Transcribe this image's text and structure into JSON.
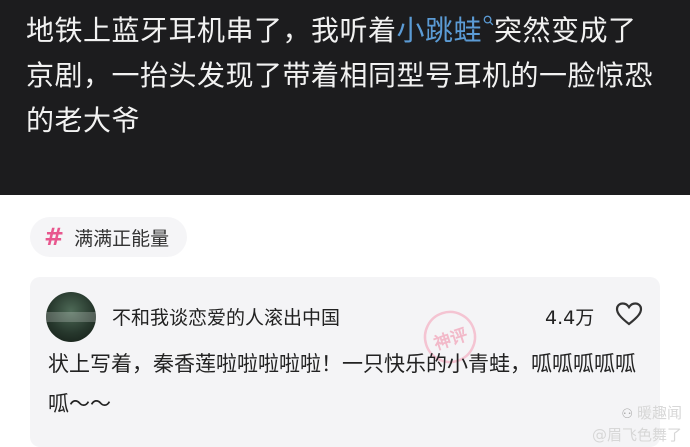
{
  "post": {
    "text_before": "地铁上蓝牙耳机串了，我听着",
    "link_text": "小跳蛙",
    "text_after": "突然变成了京剧，一抬头发现了带着相同型号耳机的一脸惊恐的老大爷"
  },
  "topic": {
    "hash": "#",
    "label": "满满正能量"
  },
  "comment": {
    "username": "不和我谈恋爱的人滚出中国",
    "likes": "4.4万",
    "text": "状上写着，秦香莲啦啦啦啦啦！一只快乐的小青蛙，呱呱呱呱呱呱～～",
    "stamp": "神评"
  },
  "watermark": {
    "line1": "暖趣闻",
    "line2": "@眉飞色舞了"
  },
  "colors": {
    "link": "#5b9bd5",
    "hash": "#e8578e",
    "dark_bg": "#1c1c1e"
  }
}
